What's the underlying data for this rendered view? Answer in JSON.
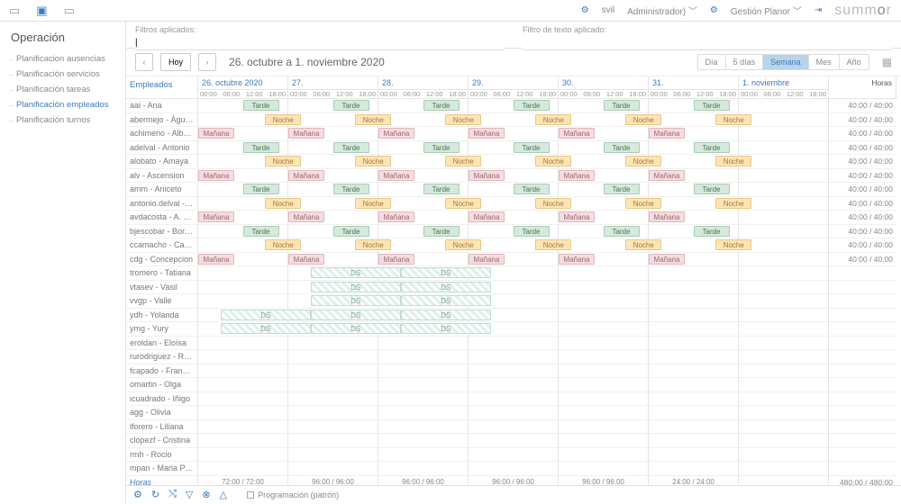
{
  "topbar": {
    "user": "svil",
    "role": "Administrador)",
    "menu": "Gestión Planor",
    "logo": "summor"
  },
  "sidebar": {
    "title": "Operación",
    "items": [
      "Planificacion ausencias",
      "Planificación servicios",
      "Planificación tareas",
      "Planificación empleados",
      "Planificación turnos"
    ],
    "active": 3
  },
  "filters": {
    "applied": "Filtros aplicados:",
    "text": "Filtro de texto aplicado:",
    "val": "|"
  },
  "datebar": {
    "today": "Hoy",
    "range": "26. octubre a 1. noviembre 2020"
  },
  "views": [
    "Día",
    "5 días",
    "Semana",
    "Mes",
    "Año"
  ],
  "activeView": 2,
  "days": [
    {
      "label": "26. octubre 2020"
    },
    {
      "label": "27."
    },
    {
      "label": "28."
    },
    {
      "label": "29."
    },
    {
      "label": "30."
    },
    {
      "label": "31."
    },
    {
      "label": "1. noviembre"
    }
  ],
  "timeTicks": [
    "00:00",
    "06:00",
    "12:00",
    "18:00"
  ],
  "empHeader": "Empleados",
  "hoursHeader": "Horas",
  "shiftLabels": {
    "tarde": "Tarde",
    "noche": "Noche",
    "manana": "Mañana",
    "ds": "DS"
  },
  "employees": [
    {
      "n": "aai - Ana",
      "sh": [
        [
          "T",
          2
        ],
        [
          "T",
          2
        ],
        [
          "T",
          2
        ],
        [
          "T",
          2
        ],
        [
          "T",
          2
        ],
        [
          "T",
          2
        ]
      ],
      "h": "40:00 / 40:00"
    },
    {
      "n": "abermejo - Águeda",
      "sh": [
        [
          "N",
          3
        ],
        [
          "N",
          3
        ],
        [
          "N",
          3
        ],
        [
          "N",
          3
        ],
        [
          "N",
          3
        ],
        [
          "N",
          3
        ]
      ],
      "h": "40:00 / 40:00"
    },
    {
      "n": "achimeno - Alberto",
      "sh": [
        [
          "M",
          0
        ],
        [
          "M",
          0
        ],
        [
          "M",
          0
        ],
        [
          "M",
          0
        ],
        [
          "M",
          0
        ],
        [
          "M",
          0
        ]
      ],
      "h": "40:00 / 40:00"
    },
    {
      "n": "adelval - Antonio",
      "sh": [
        [
          "T",
          2
        ],
        [
          "T",
          2
        ],
        [
          "T",
          2
        ],
        [
          "T",
          2
        ],
        [
          "T",
          2
        ],
        [
          "T",
          2
        ]
      ],
      "h": "40:00 / 40:00"
    },
    {
      "n": "alobato - Amaya",
      "sh": [
        [
          "N",
          3
        ],
        [
          "N",
          3
        ],
        [
          "N",
          3
        ],
        [
          "N",
          3
        ],
        [
          "N",
          3
        ],
        [
          "N",
          3
        ]
      ],
      "h": "40:00 / 40:00"
    },
    {
      "n": "alv - Ascension",
      "sh": [
        [
          "M",
          0
        ],
        [
          "M",
          0
        ],
        [
          "M",
          0
        ],
        [
          "M",
          0
        ],
        [
          "M",
          0
        ],
        [
          "M",
          0
        ]
      ],
      "h": "40:00 / 40:00"
    },
    {
      "n": "amm - Aniceto",
      "sh": [
        [
          "T",
          2
        ],
        [
          "T",
          2
        ],
        [
          "T",
          2
        ],
        [
          "T",
          2
        ],
        [
          "T",
          2
        ],
        [
          "T",
          2
        ]
      ],
      "h": "40:00 / 40:00"
    },
    {
      "n": "antonio.delval - Anto...",
      "sh": [
        [
          "N",
          3
        ],
        [
          "N",
          3
        ],
        [
          "N",
          3
        ],
        [
          "N",
          3
        ],
        [
          "N",
          3
        ],
        [
          "N",
          3
        ]
      ],
      "h": "40:00 / 40:00"
    },
    {
      "n": "avdacosta - A. Vanesa",
      "sh": [
        [
          "M",
          0
        ],
        [
          "M",
          0
        ],
        [
          "M",
          0
        ],
        [
          "M",
          0
        ],
        [
          "M",
          0
        ],
        [
          "M",
          0
        ]
      ],
      "h": "40:00 / 40:00"
    },
    {
      "n": "bjescobar - Borja josé",
      "sh": [
        [
          "T",
          2
        ],
        [
          "T",
          2
        ],
        [
          "T",
          2
        ],
        [
          "T",
          2
        ],
        [
          "T",
          2
        ],
        [
          "T",
          2
        ]
      ],
      "h": "40:00 / 40:00"
    },
    {
      "n": "ccamacho - Carlos",
      "sh": [
        [
          "N",
          3
        ],
        [
          "N",
          3
        ],
        [
          "N",
          3
        ],
        [
          "N",
          3
        ],
        [
          "N",
          3
        ],
        [
          "N",
          3
        ]
      ],
      "h": "40:00 / 40:00"
    },
    {
      "n": "cdg - Concepcion",
      "sh": [
        [
          "M",
          0
        ],
        [
          "M",
          0
        ],
        [
          "M",
          0
        ],
        [
          "M",
          0
        ],
        [
          "M",
          0
        ],
        [
          "M",
          0
        ]
      ],
      "h": "40:00 / 40:00"
    },
    {
      "n": "tromero - Tatiana",
      "sh": [
        null,
        [
          "D",
          1
        ],
        [
          "D",
          1
        ]
      ],
      "h": ""
    },
    {
      "n": "vtasev - Vasil",
      "sh": [
        null,
        [
          "D",
          1
        ],
        [
          "D",
          1
        ]
      ],
      "h": ""
    },
    {
      "n": "vvgp - Valle",
      "sh": [
        null,
        [
          "D",
          1
        ],
        [
          "D",
          1
        ]
      ],
      "h": ""
    },
    {
      "n": "ydh - Yolanda",
      "sh": [
        [
          "D",
          1
        ],
        [
          "D",
          1
        ],
        [
          "D",
          1
        ]
      ],
      "h": ""
    },
    {
      "n": "ymg - Yury",
      "sh": [
        [
          "D",
          1
        ],
        [
          "D",
          1
        ],
        [
          "D",
          1
        ]
      ],
      "h": ""
    },
    {
      "n": "eroldan - Eloísa",
      "sh": [],
      "h": ""
    },
    {
      "n": "rurodriguez - Ruben",
      "sh": [],
      "h": ""
    },
    {
      "n": "fcapado - Francisco",
      "sh": [],
      "h": ""
    },
    {
      "n": "omartin - Olga",
      "sh": [],
      "h": ""
    },
    {
      "n": "icuadrado - Iñigo",
      "sh": [],
      "h": ""
    },
    {
      "n": "agg - Olivia",
      "sh": [],
      "h": ""
    },
    {
      "n": "lforero - Liliana",
      "sh": [],
      "h": ""
    },
    {
      "n": "clopezf - Cristina",
      "sh": [],
      "h": ""
    },
    {
      "n": "rmh - Rocio",
      "sh": [],
      "h": ""
    },
    {
      "n": "mpan - Maria Pino",
      "sh": [],
      "h": ""
    }
  ],
  "totals": {
    "label": "Horas",
    "days": [
      "72:00 / 72:00",
      "96:00 / 96:00",
      "96:00 / 96:00",
      "96:00 / 96:00",
      "96:00 / 96:00",
      "24:00 / 24:00",
      ""
    ],
    "total": "480:00 / 480:00"
  },
  "legend": "Programación (patrón)"
}
